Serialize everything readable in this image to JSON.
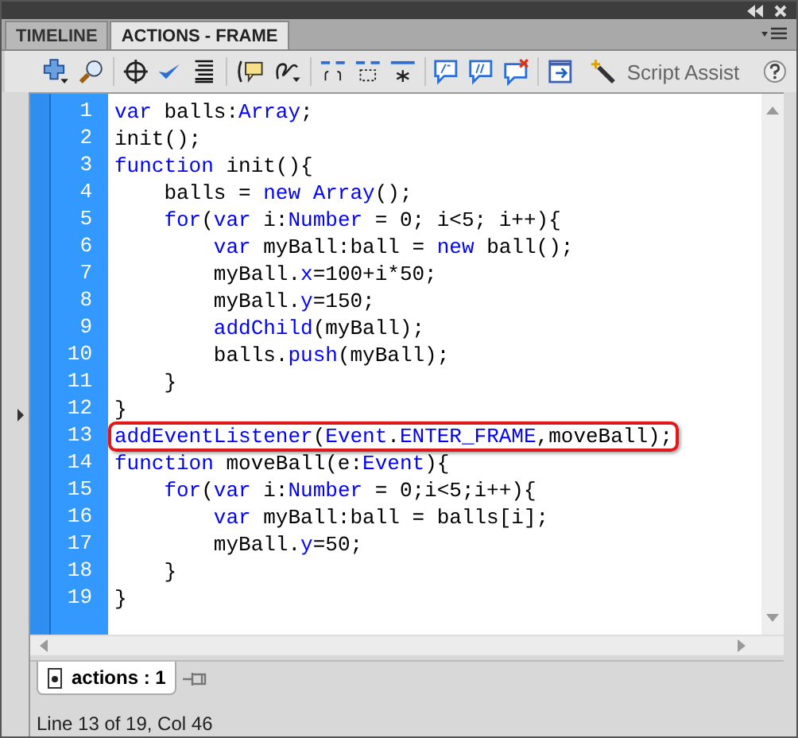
{
  "tabs": [
    {
      "label": "TIMELINE",
      "selected": false
    },
    {
      "label": "ACTIONS - FRAME",
      "selected": true
    }
  ],
  "toolbar": {
    "script_assist": "Script Assist"
  },
  "code_lines": [
    {
      "number": "1",
      "highlighted": false,
      "tokens": [
        {
          "text": "var",
          "kind": "keyword"
        },
        {
          "text": " balls:",
          "kind": "plain"
        },
        {
          "text": "Array",
          "kind": "keyword"
        },
        {
          "text": ";",
          "kind": "plain"
        }
      ]
    },
    {
      "number": "2",
      "highlighted": false,
      "tokens": [
        {
          "text": "init();",
          "kind": "plain"
        }
      ]
    },
    {
      "number": "3",
      "highlighted": false,
      "tokens": [
        {
          "text": "function",
          "kind": "keyword"
        },
        {
          "text": " init(){",
          "kind": "plain"
        }
      ]
    },
    {
      "number": "4",
      "highlighted": false,
      "tokens": [
        {
          "text": "    balls = ",
          "kind": "plain"
        },
        {
          "text": "new Array",
          "kind": "keyword"
        },
        {
          "text": "();",
          "kind": "plain"
        }
      ]
    },
    {
      "number": "5",
      "highlighted": false,
      "tokens": [
        {
          "text": "    for",
          "kind": "keyword"
        },
        {
          "text": "(",
          "kind": "plain"
        },
        {
          "text": "var",
          "kind": "keyword"
        },
        {
          "text": " i:",
          "kind": "plain"
        },
        {
          "text": "Number",
          "kind": "keyword"
        },
        {
          "text": " = 0; i<5; i++){",
          "kind": "plain"
        }
      ]
    },
    {
      "number": "6",
      "highlighted": false,
      "tokens": [
        {
          "text": "        var",
          "kind": "keyword"
        },
        {
          "text": " myBall:ball = ",
          "kind": "plain"
        },
        {
          "text": "new",
          "kind": "keyword"
        },
        {
          "text": " ball();",
          "kind": "plain"
        }
      ]
    },
    {
      "number": "7",
      "highlighted": false,
      "tokens": [
        {
          "text": "        myBall.",
          "kind": "plain"
        },
        {
          "text": "x",
          "kind": "keyword"
        },
        {
          "text": "=100+i*50;",
          "kind": "plain"
        }
      ]
    },
    {
      "number": "8",
      "highlighted": false,
      "tokens": [
        {
          "text": "        myBall.",
          "kind": "plain"
        },
        {
          "text": "y",
          "kind": "keyword"
        },
        {
          "text": "=150;",
          "kind": "plain"
        }
      ]
    },
    {
      "number": "9",
      "highlighted": false,
      "tokens": [
        {
          "text": "        addChild",
          "kind": "keyword"
        },
        {
          "text": "(myBall);",
          "kind": "plain"
        }
      ]
    },
    {
      "number": "10",
      "highlighted": false,
      "tokens": [
        {
          "text": "        balls.",
          "kind": "plain"
        },
        {
          "text": "push",
          "kind": "keyword"
        },
        {
          "text": "(myBall);",
          "kind": "plain"
        }
      ]
    },
    {
      "number": "11",
      "highlighted": false,
      "tokens": [
        {
          "text": "    }",
          "kind": "plain"
        }
      ]
    },
    {
      "number": "12",
      "highlighted": false,
      "tokens": [
        {
          "text": "}",
          "kind": "plain"
        }
      ]
    },
    {
      "number": "13",
      "highlighted": true,
      "tokens": [
        {
          "text": "addEventListener",
          "kind": "keyword"
        },
        {
          "text": "(",
          "kind": "plain"
        },
        {
          "text": "Event",
          "kind": "keyword"
        },
        {
          "text": ".",
          "kind": "plain"
        },
        {
          "text": "ENTER_FRAME",
          "kind": "keyword"
        },
        {
          "text": ",moveBall);",
          "kind": "plain"
        }
      ]
    },
    {
      "number": "14",
      "highlighted": false,
      "tokens": [
        {
          "text": "function",
          "kind": "keyword"
        },
        {
          "text": " moveBall(e:",
          "kind": "plain"
        },
        {
          "text": "Event",
          "kind": "keyword"
        },
        {
          "text": "){",
          "kind": "plain"
        }
      ]
    },
    {
      "number": "15",
      "highlighted": false,
      "tokens": [
        {
          "text": "    for",
          "kind": "keyword"
        },
        {
          "text": "(",
          "kind": "plain"
        },
        {
          "text": "var",
          "kind": "keyword"
        },
        {
          "text": " i:",
          "kind": "plain"
        },
        {
          "text": "Number",
          "kind": "keyword"
        },
        {
          "text": " = 0;i<5;i++){",
          "kind": "plain"
        }
      ]
    },
    {
      "number": "16",
      "highlighted": false,
      "tokens": [
        {
          "text": "        var",
          "kind": "keyword"
        },
        {
          "text": " myBall:ball = balls[i];",
          "kind": "plain"
        }
      ]
    },
    {
      "number": "17",
      "highlighted": false,
      "tokens": [
        {
          "text": "        myBall.",
          "kind": "plain"
        },
        {
          "text": "y",
          "kind": "keyword"
        },
        {
          "text": "=50;",
          "kind": "plain"
        }
      ]
    },
    {
      "number": "18",
      "highlighted": false,
      "tokens": [
        {
          "text": "    }",
          "kind": "plain"
        }
      ]
    },
    {
      "number": "19",
      "highlighted": false,
      "tokens": [
        {
          "text": "}",
          "kind": "plain"
        }
      ]
    }
  ],
  "file_tabs": [
    {
      "label": "actions : 1",
      "selected": true
    }
  ],
  "status_bar": "Line 13 of 19, Col 46"
}
